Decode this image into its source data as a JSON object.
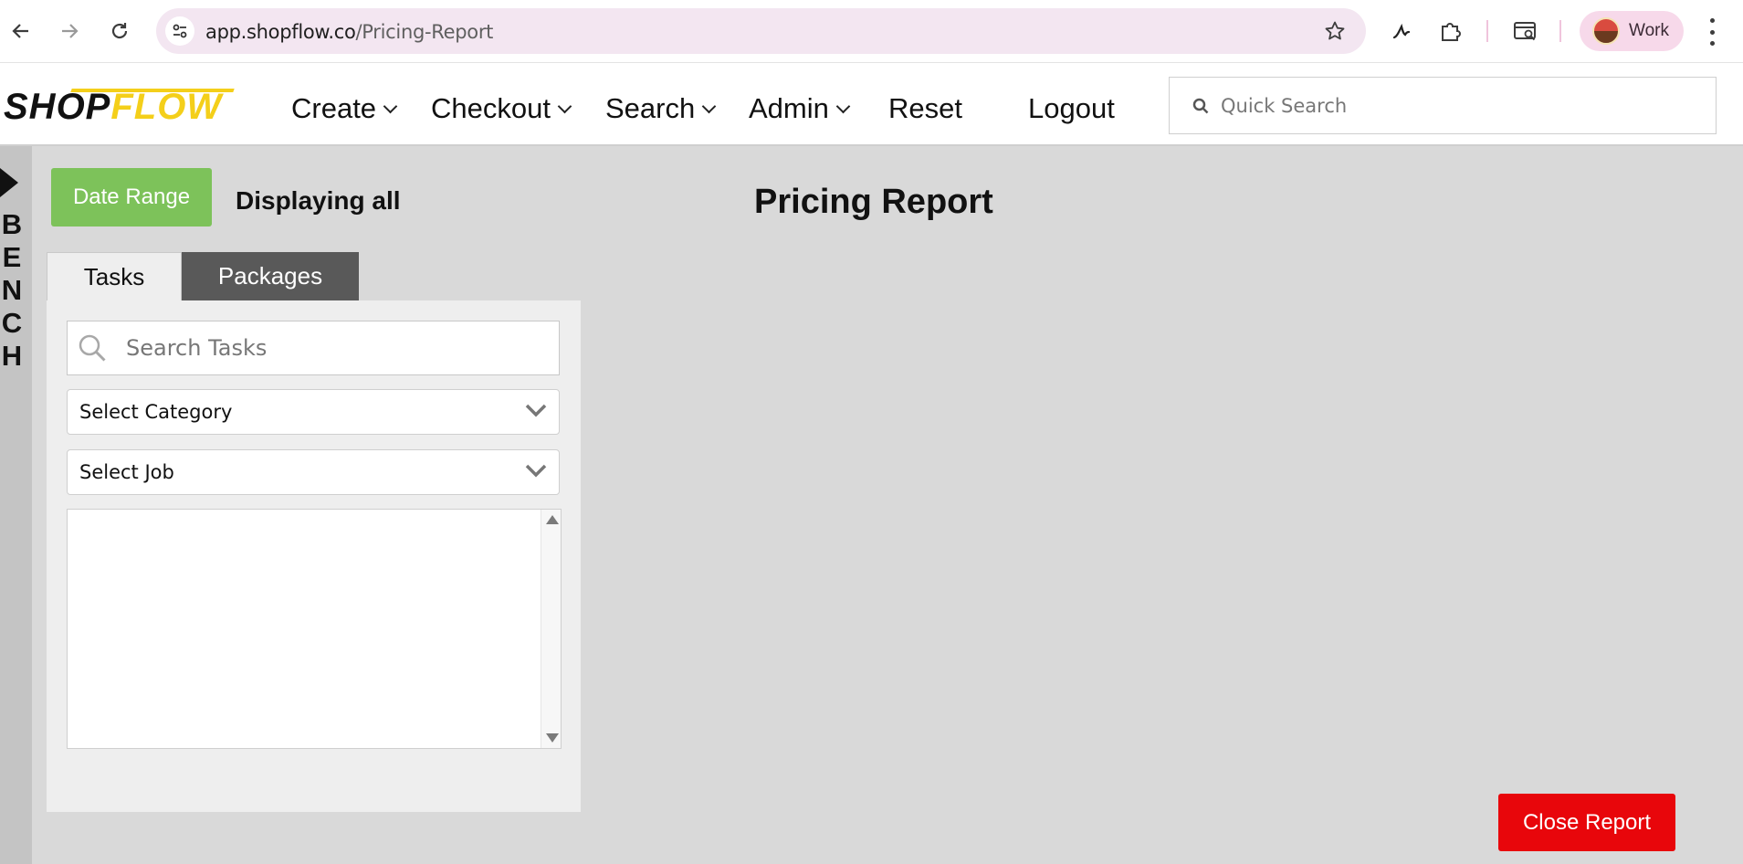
{
  "browser": {
    "url_host": "app.shopflow.co",
    "url_path": "/Pricing-Report",
    "profile_label": "Work"
  },
  "header": {
    "logo_part1": "SHOP",
    "logo_part2": "FLOW",
    "nav": [
      {
        "label": "Create",
        "has_dropdown": true
      },
      {
        "label": "Checkout",
        "has_dropdown": true
      },
      {
        "label": "Search",
        "has_dropdown": true
      },
      {
        "label": "Admin",
        "has_dropdown": true
      },
      {
        "label": "Reset",
        "has_dropdown": false
      },
      {
        "label": "Logout",
        "has_dropdown": false
      }
    ],
    "quick_search_placeholder": "Quick Search"
  },
  "bench": {
    "letters": [
      "B",
      "E",
      "N",
      "C",
      "H"
    ]
  },
  "toolbar": {
    "date_range_label": "Date Range",
    "displaying_text": "Displaying all"
  },
  "page": {
    "title": "Pricing Report"
  },
  "tabs": {
    "tasks": "Tasks",
    "packages": "Packages",
    "active": "Packages"
  },
  "panel": {
    "search_placeholder": "Search Tasks",
    "category_select": "Select Category",
    "job_select": "Select Job"
  },
  "footer": {
    "close_label": "Close Report"
  },
  "colors": {
    "date_range_bg": "#7dc25a",
    "close_bg": "#e8060b",
    "active_tab_bg": "#595959",
    "logo_accent": "#f4cf1a"
  }
}
